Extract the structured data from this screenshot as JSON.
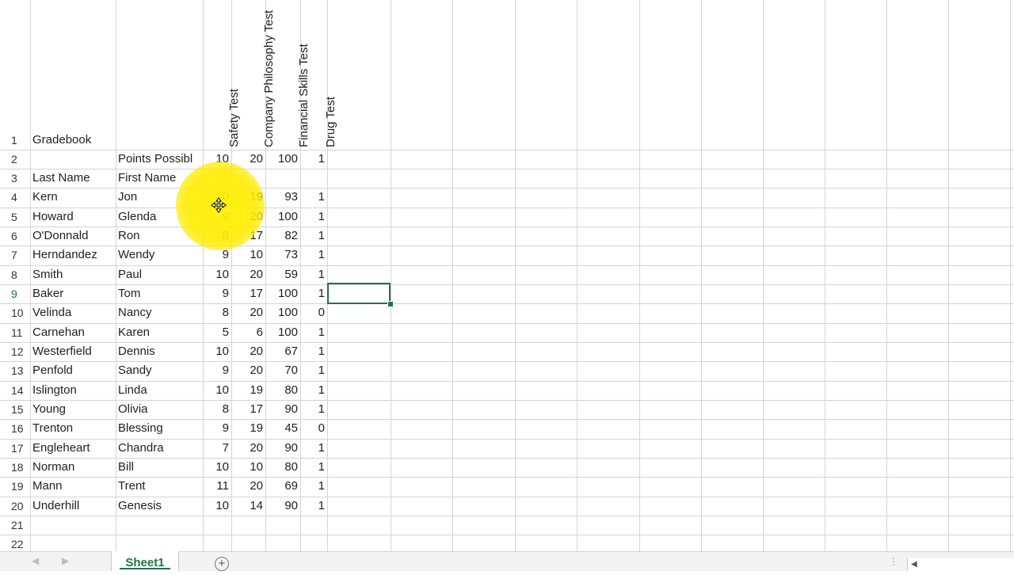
{
  "sheet": {
    "title": "Gradebook",
    "points_label": "Points Possibl",
    "last_name_label": "Last Name",
    "first_name_label": "First Name",
    "test_headers": [
      "Safety Test",
      "Company Philosophy Test",
      "Financial Skills Test",
      "Drug Test"
    ],
    "points_possible": [
      "10",
      "20",
      "100",
      "1"
    ],
    "rows": [
      {
        "last": "Kern",
        "first": "Jon",
        "scores": [
          "10",
          "19",
          "93",
          "1"
        ]
      },
      {
        "last": "Howard",
        "first": "Glenda",
        "scores": [
          "9",
          "20",
          "100",
          "1"
        ]
      },
      {
        "last": "O'Donnald",
        "first": "Ron",
        "scores": [
          "8",
          "17",
          "82",
          "1"
        ]
      },
      {
        "last": "Herndandez",
        "first": "Wendy",
        "scores": [
          "9",
          "10",
          "73",
          "1"
        ]
      },
      {
        "last": "Smith",
        "first": "Paul",
        "scores": [
          "10",
          "20",
          "59",
          "1"
        ]
      },
      {
        "last": "Baker",
        "first": "Tom",
        "scores": [
          "9",
          "17",
          "100",
          "1"
        ]
      },
      {
        "last": "Velinda",
        "first": "Nancy",
        "scores": [
          "8",
          "20",
          "100",
          "0"
        ]
      },
      {
        "last": "Carnehan",
        "first": "Karen",
        "scores": [
          "5",
          "6",
          "100",
          "1"
        ]
      },
      {
        "last": "Westerfield",
        "first": "Dennis",
        "scores": [
          "10",
          "20",
          "67",
          "1"
        ]
      },
      {
        "last": "Penfold",
        "first": "Sandy",
        "scores": [
          "9",
          "20",
          "70",
          "1"
        ]
      },
      {
        "last": "Islington",
        "first": "Linda",
        "scores": [
          "10",
          "19",
          "80",
          "1"
        ]
      },
      {
        "last": "Young",
        "first": "Olivia",
        "scores": [
          "8",
          "17",
          "90",
          "1"
        ]
      },
      {
        "last": "Trenton",
        "first": "Blessing",
        "scores": [
          "9",
          "19",
          "45",
          "0"
        ]
      },
      {
        "last": "Engleheart",
        "first": "Chandra",
        "scores": [
          "7",
          "20",
          "90",
          "1"
        ]
      },
      {
        "last": "Norman",
        "first": "Bill",
        "scores": [
          "10",
          "10",
          "80",
          "1"
        ]
      },
      {
        "last": "Mann",
        "first": "Trent",
        "scores": [
          "11",
          "20",
          "69",
          "1"
        ]
      },
      {
        "last": "Underhill",
        "first": "Genesis",
        "scores": [
          "10",
          "14",
          "90",
          "1"
        ]
      }
    ],
    "row_numbers": [
      "1",
      "2",
      "3",
      "4",
      "5",
      "6",
      "7",
      "8",
      "9",
      "10",
      "11",
      "12",
      "13",
      "14",
      "15",
      "16",
      "17",
      "18",
      "19",
      "20",
      "21",
      "22"
    ],
    "active_row": "9"
  },
  "tabs": {
    "active_sheet": "Sheet1",
    "add_sheet_icon": "+"
  },
  "colors": {
    "accent": "#217346",
    "highlight": "#ffec00"
  }
}
